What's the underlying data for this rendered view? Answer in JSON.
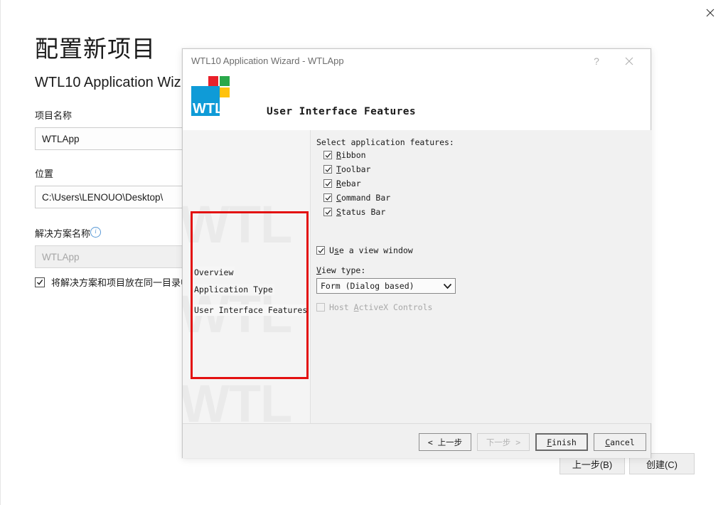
{
  "vs": {
    "page_title": "配置新项目",
    "subtitle": "WTL10 Application Wiz",
    "close_icon": "close-icon",
    "fields": {
      "project_name_label": "项目名称",
      "project_name_value": "WTLApp",
      "location_label": "位置",
      "location_value": "C:\\Users\\LENOUO\\Desktop\\",
      "solution_name_label": "解决方案名称",
      "solution_info_icon": "info-icon",
      "solution_name_value": "WTLApp",
      "same_directory_label": "将解决方案和项目放在同一目录中",
      "same_directory_checked": true
    },
    "buttons": {
      "back": "上一步(B)",
      "create": "创建(C)"
    }
  },
  "wizard": {
    "title": "WTL10 Application Wizard - WTLApp",
    "help_icon": "?",
    "close_icon": "close-icon",
    "heading": "User Interface Features",
    "logo": {
      "text": "WTL",
      "blue": "#0f9bd7",
      "red": "#e8202a",
      "green": "#2ba84a",
      "yellow": "#ffc20e"
    },
    "nav": {
      "items": [
        {
          "label": "Overview"
        },
        {
          "label": "Application Type"
        },
        {
          "label": "User Interface Features"
        }
      ],
      "selected_index": 2,
      "watermark": "WTL",
      "highlight_color": "#e31010"
    },
    "content": {
      "features_title": "Select application features:",
      "features": [
        {
          "label": "Ribbon",
          "accel": "R",
          "rest": "ibbon",
          "checked": true,
          "enabled": true
        },
        {
          "label": "Toolbar",
          "accel": "T",
          "rest": "oolbar",
          "checked": true,
          "enabled": true
        },
        {
          "label": "Rebar",
          "accel": "R",
          "rest": "ebar",
          "checked": true,
          "enabled": true
        },
        {
          "label": "Command Bar",
          "accel": "C",
          "rest": "ommand Bar",
          "checked": true,
          "enabled": true
        },
        {
          "label": "Status Bar",
          "accel": "S",
          "rest": "tatus Bar",
          "checked": true,
          "enabled": true
        }
      ],
      "use_view_window": {
        "label": "Use a view window",
        "pre": "U",
        "accel": "s",
        "rest": "e a view window",
        "checked": true,
        "enabled": true
      },
      "view_type_label": "View type:",
      "view_type_accel": "V",
      "view_type_rest": "iew type:",
      "view_type_value": "Form (Dialog based)",
      "view_type_options": [
        "Form (Dialog based)"
      ],
      "host_activex": {
        "pre": "Host ",
        "accel": "A",
        "rest": "ctiveX Controls",
        "label": "Host ActiveX Controls",
        "checked": false,
        "enabled": false
      }
    },
    "buttons": {
      "back": {
        "label": "< 上一步",
        "enabled": true,
        "focused": false
      },
      "next": {
        "label": "下一步 >",
        "enabled": false,
        "focused": false
      },
      "finish": {
        "pre": "F",
        "rest": "inish",
        "label": "Finish",
        "enabled": true,
        "focused": true
      },
      "cancel": {
        "pre": "C",
        "rest": "ancel",
        "label": "Cancel",
        "enabled": true,
        "focused": false
      }
    }
  }
}
